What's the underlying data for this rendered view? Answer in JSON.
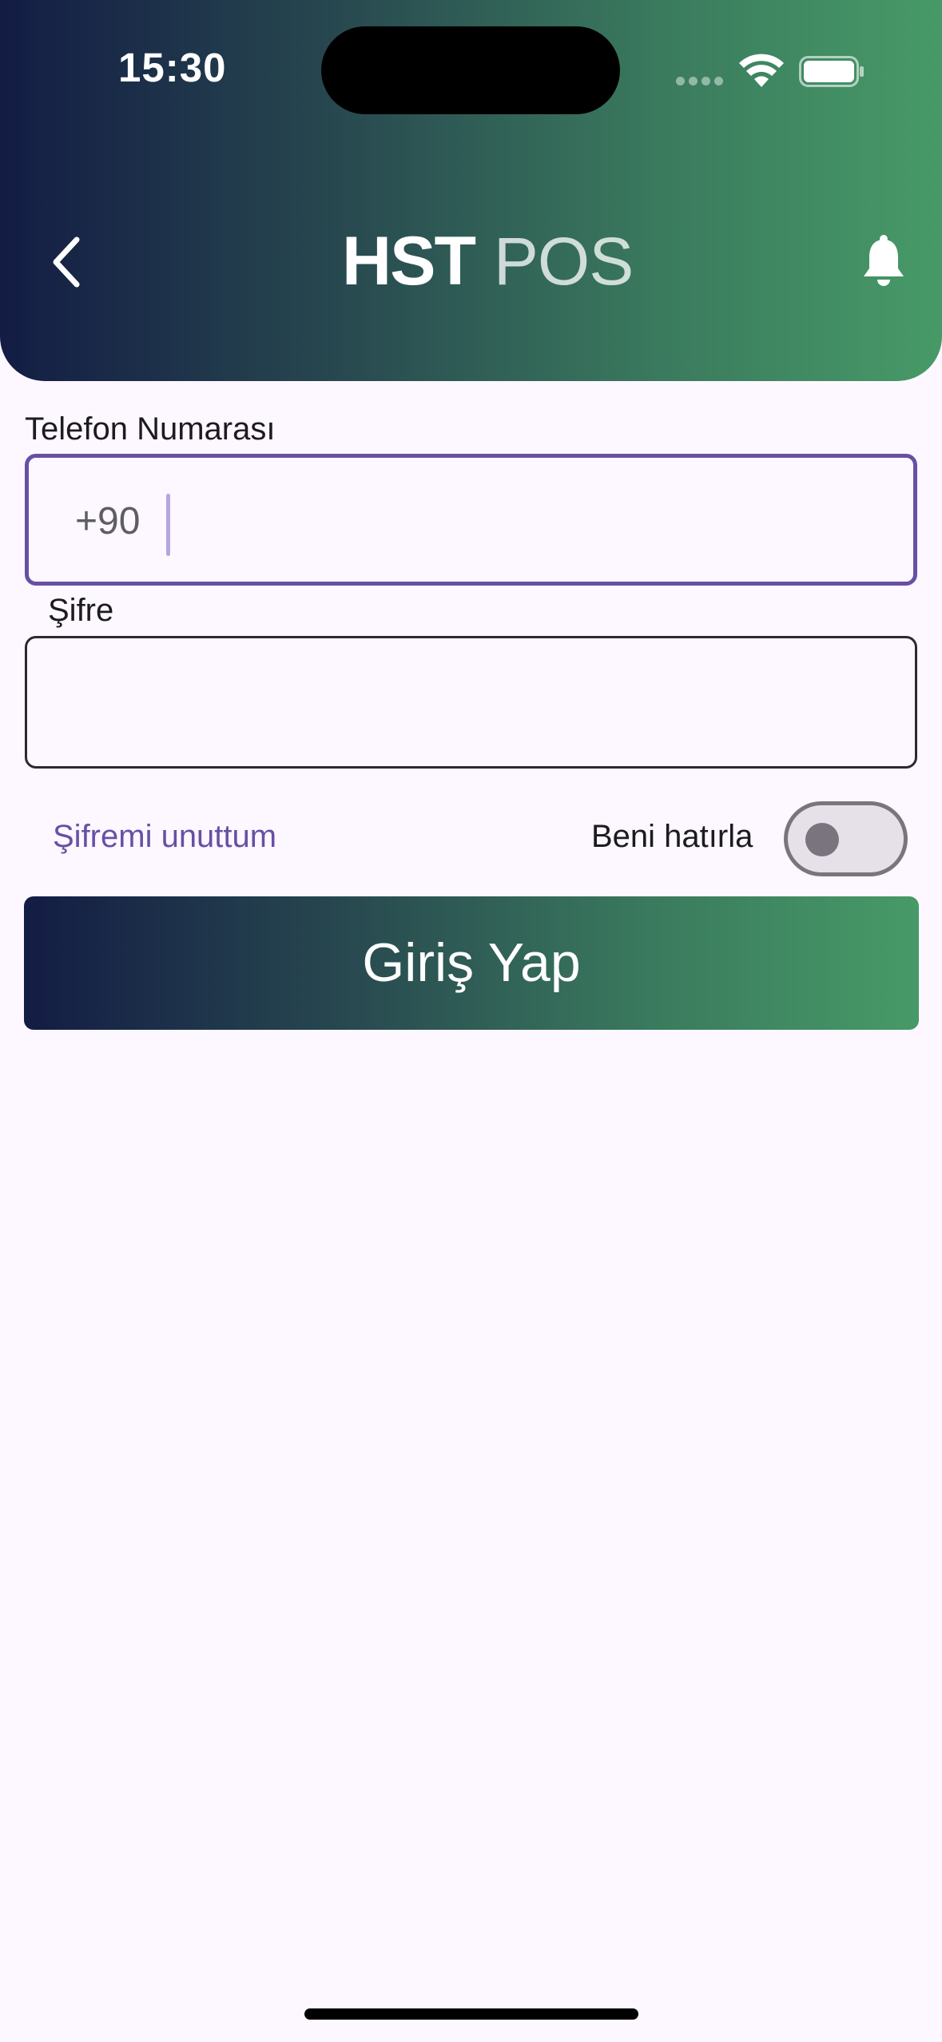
{
  "status_bar": {
    "time": "15:30",
    "icons": [
      "cellular-signal-icon",
      "wifi-icon",
      "battery-icon"
    ]
  },
  "header": {
    "logo_bold": "HST",
    "logo_thin": "POS",
    "back_icon": "chevron-left-icon",
    "notification_icon": "bell-icon",
    "gradient_colors": [
      "#131c44",
      "#27474f",
      "#3a7a5e",
      "#479a67"
    ]
  },
  "form": {
    "phone": {
      "label": "Telefon Numarası",
      "prefix": "+90",
      "value": ""
    },
    "password": {
      "label": "Şifre",
      "value": ""
    },
    "forgot_password": "Şifremi unuttum",
    "remember_me": {
      "label": "Beni hatırla",
      "checked": false
    },
    "submit_label": "Giriş Yap"
  },
  "colors": {
    "accent": "#6750a4",
    "background": "#fdf7ff"
  }
}
